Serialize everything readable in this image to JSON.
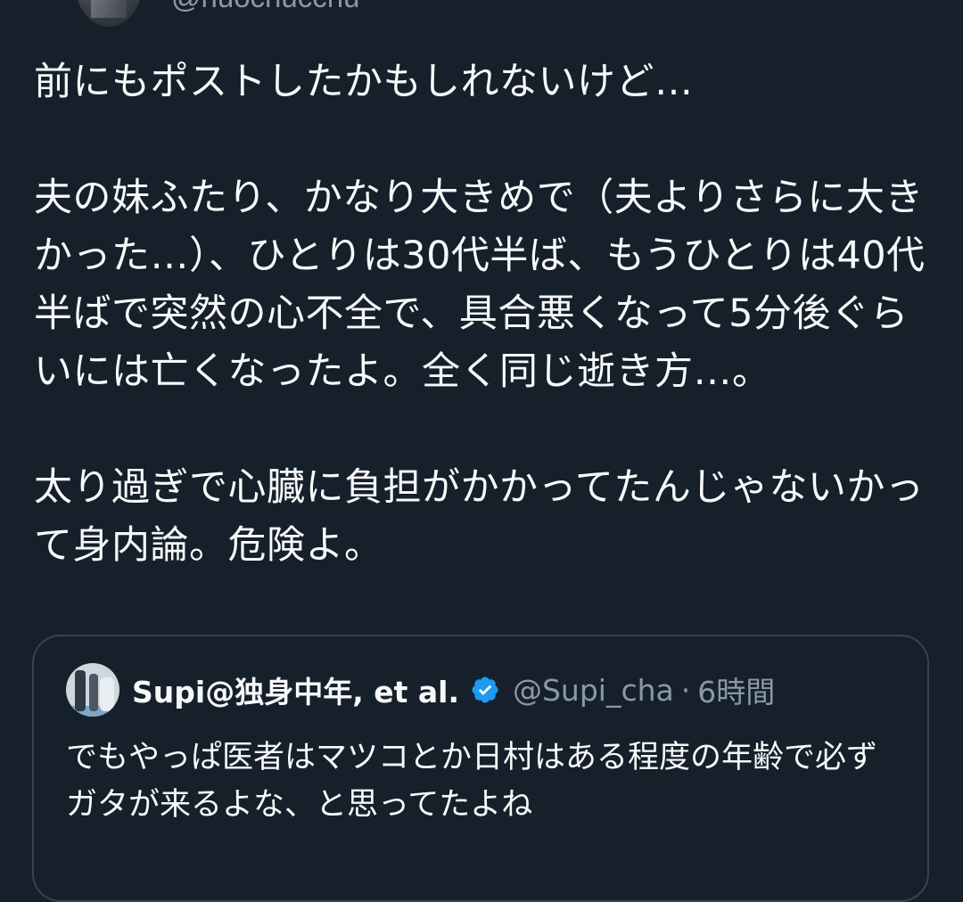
{
  "author": {
    "handle": "@nuochucchu"
  },
  "tweet": {
    "text": "前にもポストしたかもしれないけど…\n\n夫の妹ふたり、かなり大きめで（夫よりさらに大きかった…）、ひとりは30代半ば、もうひとりは40代半ばで突然の心不全で、具合悪くなって5分後ぐらいには亡くなったよ。全く同じ逝き方…。\n\n太り過ぎで心臓に負担がかかってたんじゃないかって身内論。危険よ。"
  },
  "quote": {
    "name": "Supi@独身中年, et al.",
    "handle": "@Supi_cha",
    "separator": "·",
    "time": "6時間",
    "text": "でもやっぱ医者はマツコとか日村はある程度の年齢で必ずガタが来るよな、と思ってたよね",
    "verified_color": "#1d9bf0"
  },
  "colors": {
    "background": "#15202b",
    "text": "#f7f9f9",
    "secondary": "#8b98a5",
    "border": "#38444d"
  }
}
